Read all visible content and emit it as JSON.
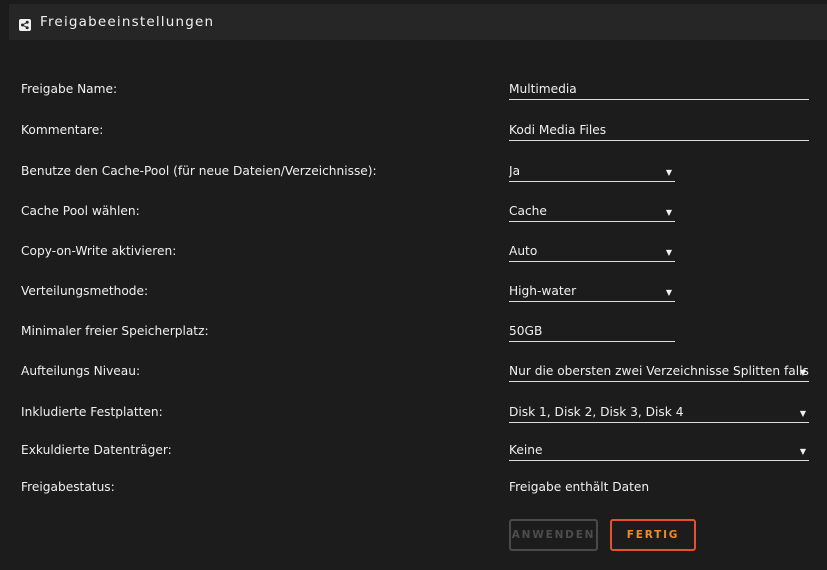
{
  "header": {
    "title": "Freigabeeinstellungen",
    "icon": "share-icon"
  },
  "fields": [
    {
      "label": "Freigabe Name:",
      "value": "Multimedia",
      "type": "text"
    },
    {
      "label": "Kommentare:",
      "value": "Kodi Media Files",
      "type": "text"
    },
    {
      "label": "Benutze den Cache-Pool (für neue Dateien/Verzeichnisse):",
      "value": "Ja",
      "type": "select"
    },
    {
      "label": "Cache Pool wählen:",
      "value": "Cache",
      "type": "select"
    },
    {
      "label": "Copy-on-Write aktivieren:",
      "value": "Auto",
      "type": "select"
    },
    {
      "label": "Verteilungsmethode:",
      "value": "High-water",
      "type": "select"
    },
    {
      "label": "Minimaler freier Speicherplatz:",
      "value": "50GB",
      "type": "text"
    },
    {
      "label": "Aufteilungs Niveau:",
      "value": "Nur die obersten zwei Verzeichnisse Splitten falls erforderlich",
      "type": "select"
    },
    {
      "label": "Inkludierte Festplatten:",
      "value": "Disk 1, Disk 2, Disk 3, Disk 4",
      "type": "select"
    },
    {
      "label": "Exkuldierte Datenträger:",
      "value": "Keine",
      "type": "select"
    },
    {
      "label": "Freigabestatus:",
      "value": "Freigabe enthält Daten",
      "type": "static"
    }
  ],
  "buttons": {
    "apply": "ANWENDEN",
    "done": "FERTIG"
  },
  "colors": {
    "background": "#1c1c1c",
    "header": "#262626",
    "accent_border": "#e6502e",
    "accent_text": "#f18b24"
  }
}
